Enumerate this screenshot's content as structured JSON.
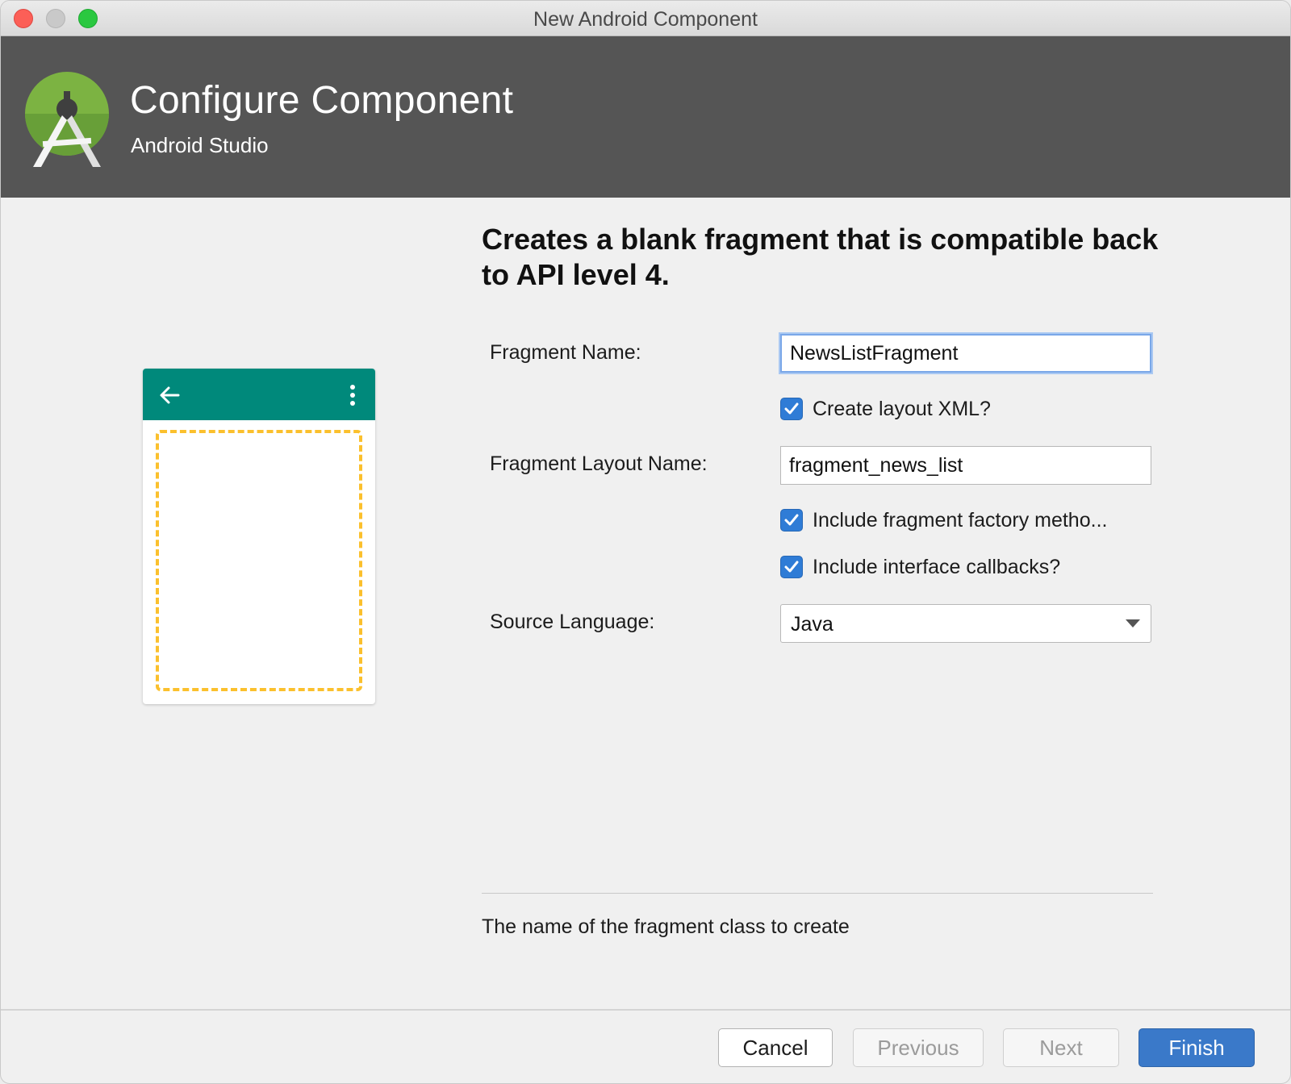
{
  "window": {
    "title": "New Android Component"
  },
  "header": {
    "title": "Configure Component",
    "subtitle": "Android Studio",
    "logo_icon": "android-studio-logo-icon"
  },
  "preview": {
    "toolbar_color": "#00897b",
    "placeholder_color": "#fbc02d",
    "back_icon": "arrow-left-icon",
    "menu_icon": "more-vertical-icon"
  },
  "description": "Creates a blank fragment that is compatible back to API level 4.",
  "form": {
    "fragment_name": {
      "label": "Fragment Name:",
      "value": "NewsListFragment"
    },
    "create_layout_xml": {
      "label": "Create layout XML?",
      "checked": true
    },
    "fragment_layout_name": {
      "label": "Fragment Layout Name:",
      "value": "fragment_news_list"
    },
    "include_factory_methods": {
      "label": "Include fragment factory metho...",
      "checked": true
    },
    "include_interface_callbacks": {
      "label": "Include interface callbacks?",
      "checked": true
    },
    "source_language": {
      "label": "Source Language:",
      "value": "Java"
    }
  },
  "help_text": "The name of the fragment class to create",
  "buttons": {
    "cancel": "Cancel",
    "previous": "Previous",
    "next": "Next",
    "finish": "Finish"
  },
  "colors": {
    "header_bg": "#555555",
    "accent": "#3a79c9",
    "checkbox": "#2f7cd6"
  }
}
